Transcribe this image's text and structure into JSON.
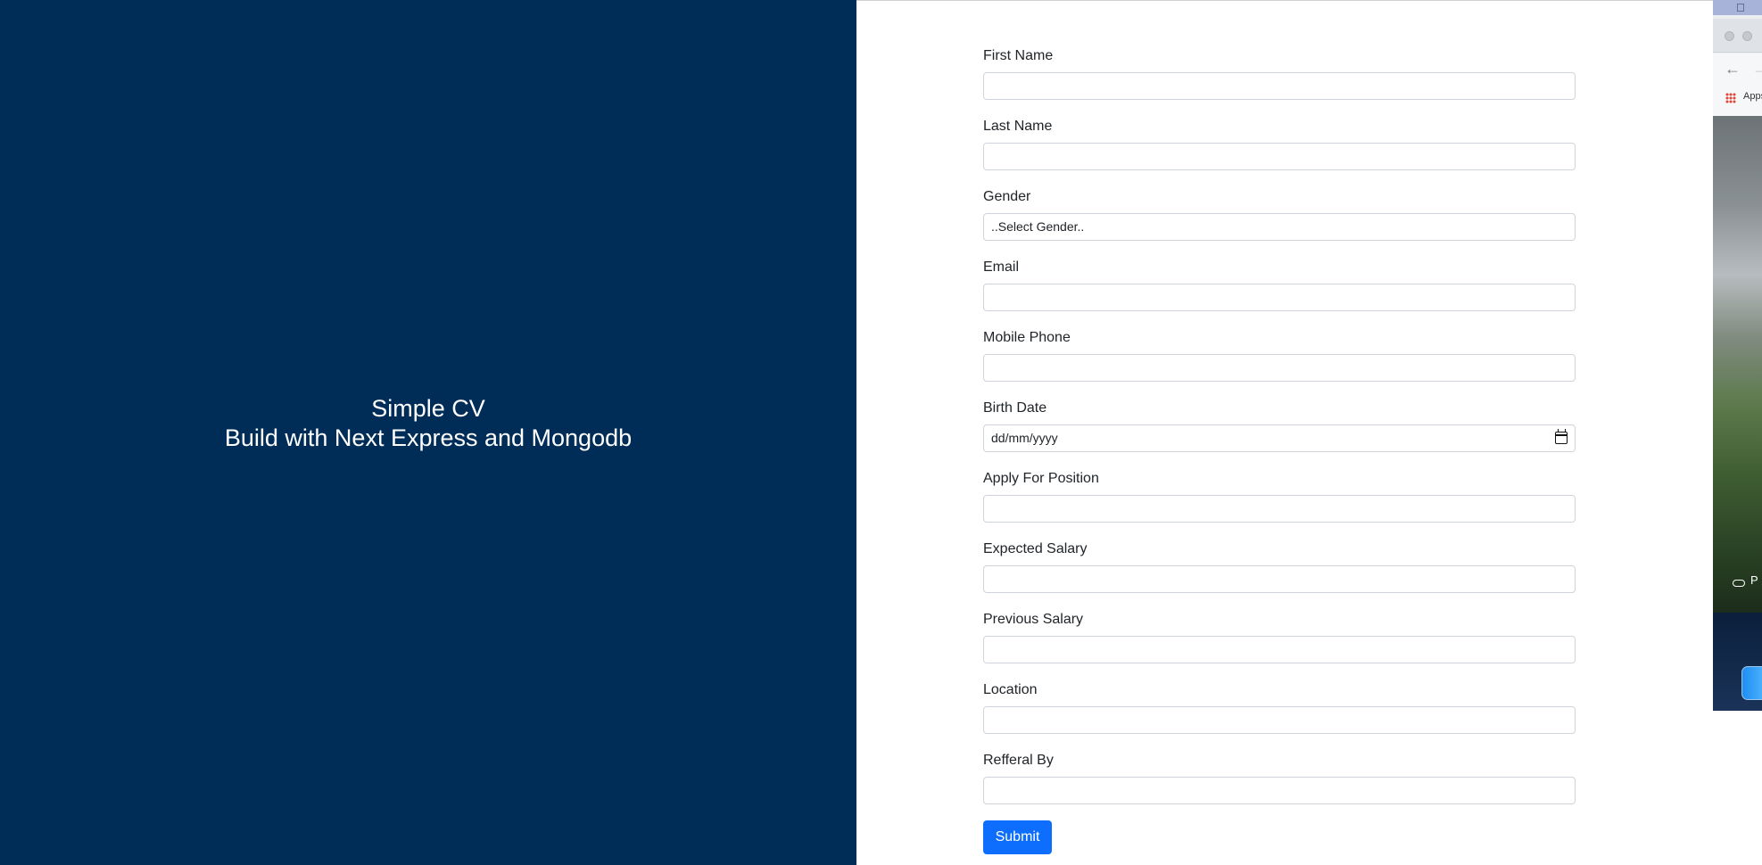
{
  "hero": {
    "title_line1": "Simple CV",
    "title_line2": "Build with Next Express and Mongodb",
    "background_color": "#002d58"
  },
  "form": {
    "fields": [
      {
        "label": "First Name",
        "type": "text",
        "value": ""
      },
      {
        "label": "Last Name",
        "type": "text",
        "value": ""
      },
      {
        "label": "Gender",
        "type": "select",
        "selected": "..Select Gender.."
      },
      {
        "label": "Email",
        "type": "text",
        "value": ""
      },
      {
        "label": "Mobile Phone",
        "type": "text",
        "value": ""
      },
      {
        "label": "Birth Date",
        "type": "date",
        "placeholder": "dd/mm/yyyy",
        "icon": "calendar-icon"
      },
      {
        "label": "Apply For Position",
        "type": "text",
        "value": ""
      },
      {
        "label": "Expected Salary",
        "type": "text",
        "value": ""
      },
      {
        "label": "Previous Salary",
        "type": "text",
        "value": ""
      },
      {
        "label": "Location",
        "type": "text",
        "value": ""
      },
      {
        "label": "Refferal By",
        "type": "text",
        "value": ""
      }
    ],
    "submit_label": "Submit",
    "submit_color": "#0d6efd"
  },
  "background_window": {
    "apple_icon": "apple-logo-icon",
    "bookmarks_label": "Apps",
    "link_icon": "link-icon",
    "link_text": "P"
  }
}
